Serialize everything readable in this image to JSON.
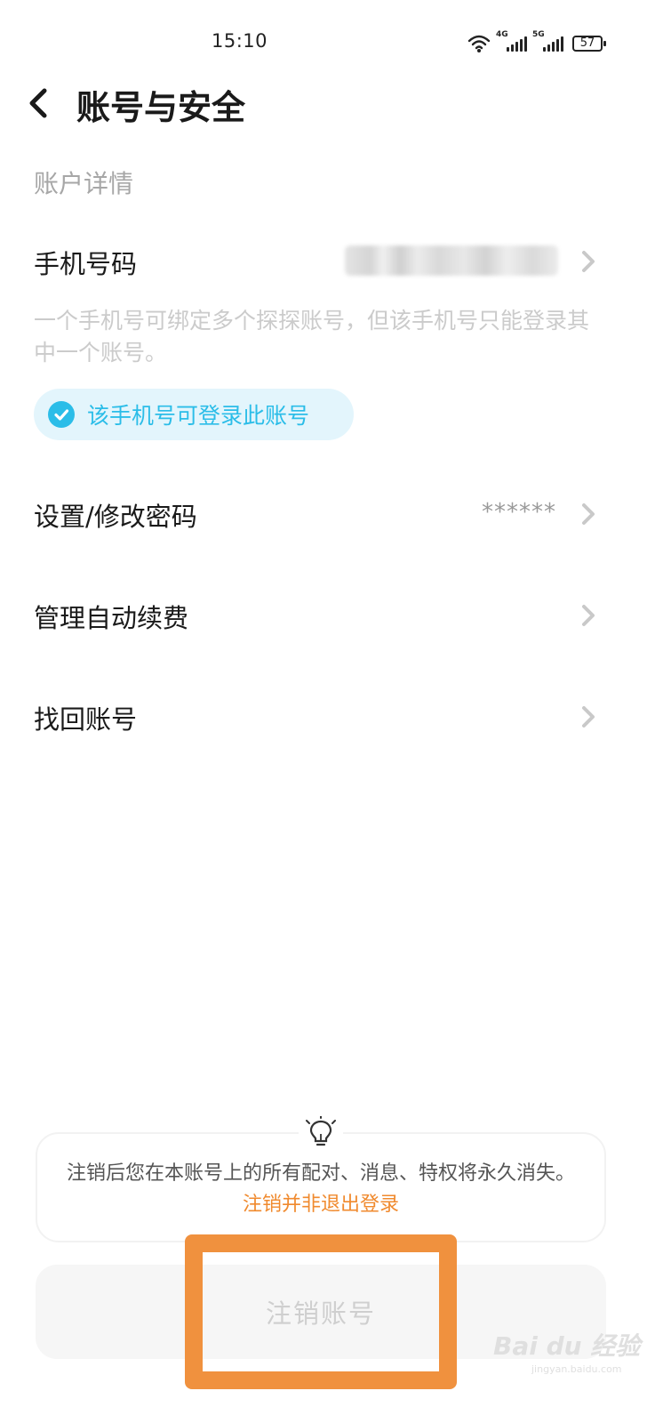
{
  "status_bar": {
    "time": "15:10",
    "net1": "4G",
    "net2": "5G",
    "battery": "57"
  },
  "header": {
    "title": "账号与安全"
  },
  "account_details": {
    "section_label": "账户详情",
    "phone": {
      "label": "手机号码",
      "hint": "一个手机号可绑定多个探探账号，但该手机号只能登录其中一个账号。",
      "badge": "该手机号可登录此账号"
    },
    "password": {
      "label": "设置/修改密码",
      "value": "******"
    },
    "auto_renew": {
      "label": "管理自动续费"
    },
    "recover": {
      "label": "找回账号"
    }
  },
  "notice": {
    "text": "注销后您在本账号上的所有配对、消息、特权将永久消失。",
    "link": "注销并非退出登录"
  },
  "cancel_button": {
    "label": "注销账号"
  },
  "watermark": {
    "text": "Bai du 经验",
    "sub": "jingyan.baidu.com"
  },
  "colors": {
    "accent_blue": "#2bbde8",
    "accent_orange": "#f08a2e",
    "highlight_box": "#f0913e"
  }
}
